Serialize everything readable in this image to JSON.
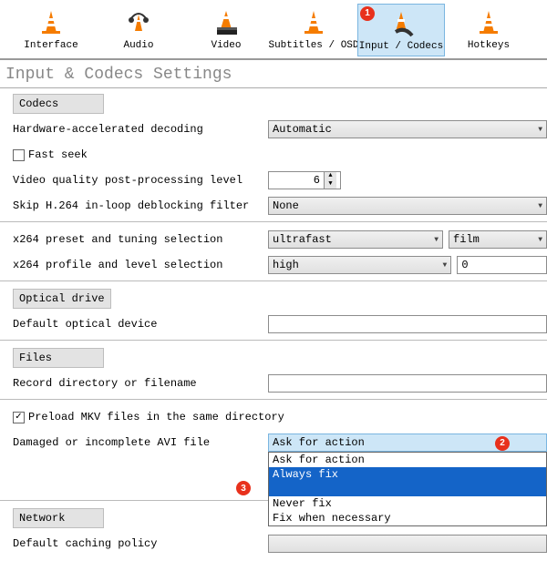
{
  "toolbar": [
    {
      "label": "Interface",
      "key": "interface"
    },
    {
      "label": "Audio",
      "key": "audio"
    },
    {
      "label": "Video",
      "key": "video"
    },
    {
      "label": "Subtitles / OSD",
      "key": "subtitles"
    },
    {
      "label": "Input / Codecs",
      "key": "input-codecs",
      "selected": true,
      "badge": "1"
    },
    {
      "label": "Hotkeys",
      "key": "hotkeys"
    }
  ],
  "page_title": "Input & Codecs Settings",
  "groups": {
    "codecs": {
      "title": "Codecs",
      "hw_decode_label": "Hardware-accelerated decoding",
      "hw_decode_value": "Automatic",
      "fast_seek_label": "Fast seek",
      "fast_seek_checked": false,
      "vq_label": "Video quality post-processing level",
      "vq_value": "6",
      "skip_h264_label": "Skip H.264 in-loop deblocking filter",
      "skip_h264_value": "None",
      "x264_preset_label": "x264 preset and tuning selection",
      "x264_preset_value": "ultrafast",
      "x264_tuning_value": "film",
      "x264_profile_label": "x264 profile and level selection",
      "x264_profile_value": "high",
      "x264_level_value": "0"
    },
    "optical": {
      "title": "Optical drive",
      "default_device_label": "Default optical device",
      "default_device_value": ""
    },
    "files": {
      "title": "Files",
      "record_dir_label": "Record directory or filename",
      "record_dir_value": "",
      "preload_mkv_label": "Preload MKV files in the same directory",
      "preload_mkv_checked": true,
      "avi_label": "Damaged or incomplete AVI file",
      "avi_selected": "Ask for action",
      "avi_options": [
        "Ask for action",
        "Always fix",
        "Never fix",
        "Fix when necessary"
      ],
      "avi_badge_sel": "2",
      "avi_badge_hl": "3"
    },
    "network": {
      "title": "Network",
      "caching_label": "Default caching policy"
    }
  }
}
